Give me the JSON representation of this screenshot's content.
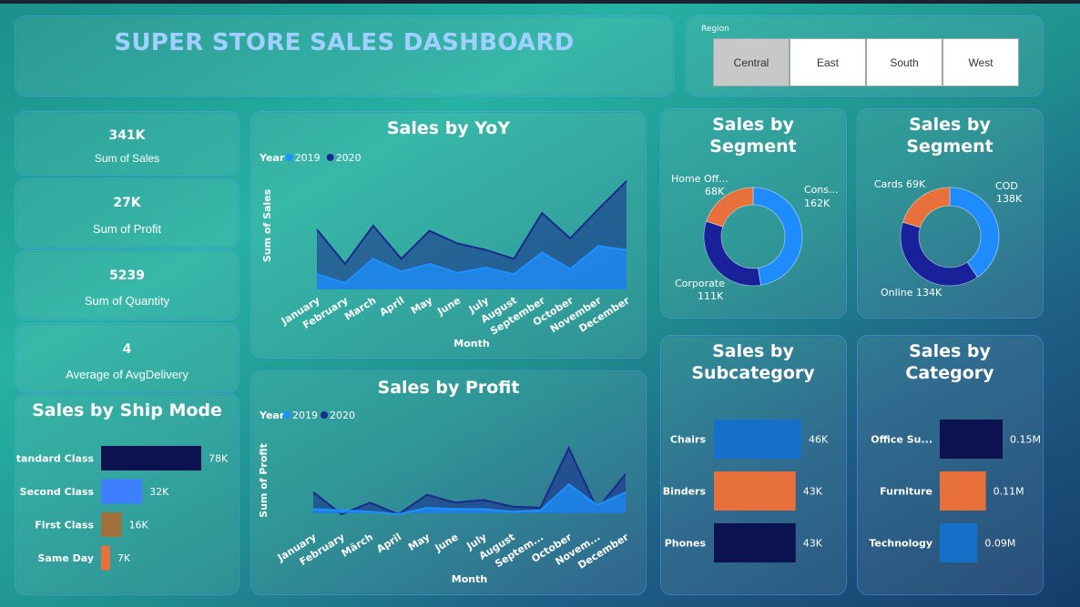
{
  "header": {
    "title": "SUPER STORE SALES DASHBOARD"
  },
  "region_slicer": {
    "label": "Region",
    "options": [
      "Central",
      "East",
      "South",
      "West"
    ],
    "selected": "Central"
  },
  "kpis": [
    {
      "value": "341K",
      "label": "Sum of Sales"
    },
    {
      "value": "27K",
      "label": "Sum of Profit"
    },
    {
      "value": "5239",
      "label": "Sum of Quantity"
    },
    {
      "value": "4",
      "label": "Average of AvgDelivery"
    }
  ],
  "colors": {
    "series_2019": "#1e90ff",
    "series_2020": "#1a2a8c",
    "orange": "#e8703a",
    "navy": "#0c1250",
    "blue": "#1470c8"
  },
  "chart_data": [
    {
      "id": "sales-yoy",
      "type": "area",
      "title": "Sales by YoY",
      "legend_title": "Year",
      "xlabel": "Month",
      "ylabel": "Sum of Sales",
      "categories": [
        "January",
        "February",
        "March",
        "April",
        "May",
        "June",
        "July",
        "August",
        "September",
        "October",
        "November",
        "December"
      ],
      "series": [
        {
          "name": "2019",
          "values": [
            12,
            5,
            24,
            14,
            20,
            13,
            17,
            12,
            29,
            16,
            34,
            31
          ]
        },
        {
          "name": "2020",
          "values": [
            47,
            20,
            50,
            24,
            46,
            36,
            31,
            24,
            60,
            40,
            63,
            85
          ]
        }
      ],
      "ylim": [
        0,
        100
      ]
    },
    {
      "id": "sales-by-profit",
      "type": "area",
      "title": "Sales by Profit",
      "legend_title": "Year",
      "xlabel": "Month",
      "ylabel": "Sum of Profit",
      "categories": [
        "January",
        "February",
        "Märch",
        "April",
        "May",
        "June",
        "July",
        "August",
        "Septem...",
        "October",
        "Novem...",
        "December"
      ],
      "series": [
        {
          "name": "2019",
          "values": [
            3,
            2,
            1,
            -1,
            4,
            3,
            3,
            1,
            2,
            22,
            6,
            16
          ]
        },
        {
          "name": "2020",
          "values": [
            16,
            -1,
            8,
            -1,
            14,
            8,
            10,
            5,
            4,
            50,
            3,
            30
          ]
        }
      ],
      "ylim": [
        -10,
        60
      ]
    },
    {
      "id": "sales-by-segment",
      "type": "pie",
      "title": "Sales by Segment",
      "slices": [
        {
          "label": "Cons...",
          "value_label": "162K",
          "value": 162
        },
        {
          "label": "Corporate",
          "value_label": "111K",
          "value": 111
        },
        {
          "label": "Home Off...",
          "value_label": "68K",
          "value": 68
        }
      ]
    },
    {
      "id": "sales-by-payment",
      "type": "pie",
      "title": "Sales by Segment",
      "slices": [
        {
          "label": "COD",
          "value_label": "138K",
          "value": 138
        },
        {
          "label": "Online",
          "value_label": "134K",
          "value": 134
        },
        {
          "label": "Cards",
          "value_label": "69K",
          "value": 69
        }
      ]
    },
    {
      "id": "sales-by-ship-mode",
      "type": "bar",
      "title": "Sales by Ship Mode",
      "categories": [
        "Standard Class",
        "Second Class",
        "First Class",
        "Same Day"
      ],
      "values": [
        78,
        32,
        16,
        7
      ],
      "value_labels": [
        "78K",
        "32K",
        "16K",
        "7K"
      ]
    },
    {
      "id": "sales-by-subcategory",
      "type": "bar",
      "title": "Sales by Subcategory",
      "categories": [
        "Chairs",
        "Binders",
        "Phones"
      ],
      "values": [
        46,
        43,
        43
      ],
      "value_labels": [
        "46K",
        "43K",
        "43K"
      ]
    },
    {
      "id": "sales-by-category",
      "type": "bar",
      "title": "Sales by Category",
      "categories": [
        "Office Su...",
        "Furniture",
        "Technology"
      ],
      "values": [
        0.15,
        0.11,
        0.09
      ],
      "value_labels": [
        "0.15M",
        "0.11M",
        "0.09M"
      ]
    }
  ]
}
